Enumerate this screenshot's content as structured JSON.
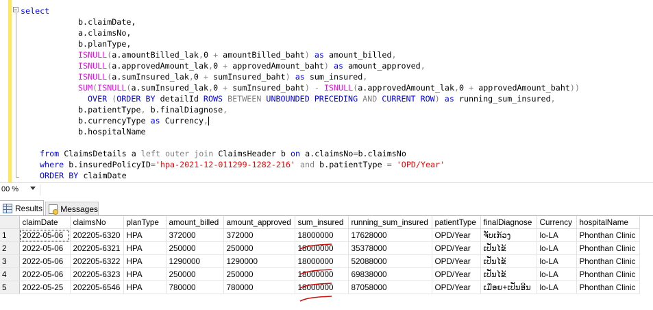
{
  "editor": {
    "lines": [
      [
        {
          "t": "select",
          "c": "kw"
        }
      ],
      [
        {
          "t": "b.claimDate,",
          "c": ""
        }
      ],
      [
        {
          "t": "a.claimsNo,",
          "c": ""
        }
      ],
      [
        {
          "t": "b.planType,",
          "c": ""
        }
      ],
      [
        {
          "t": "ISNULL",
          "c": "fn"
        },
        {
          "t": "(",
          "c": "gr"
        },
        {
          "t": "a.amountBilled_lak",
          "c": ""
        },
        {
          "t": ",",
          "c": "gr"
        },
        {
          "t": "0 ",
          "c": ""
        },
        {
          "t": "+",
          "c": "gr"
        },
        {
          "t": " amountBilled_baht",
          "c": ""
        },
        {
          "t": ")",
          "c": "gr"
        },
        {
          "t": " as ",
          "c": "kw"
        },
        {
          "t": "amount_billed",
          "c": ""
        },
        {
          "t": ",",
          "c": "gr"
        }
      ],
      [
        {
          "t": "ISNULL",
          "c": "fn"
        },
        {
          "t": "(",
          "c": "gr"
        },
        {
          "t": "a.approvedAmount_lak",
          "c": ""
        },
        {
          "t": ",",
          "c": "gr"
        },
        {
          "t": "0 ",
          "c": ""
        },
        {
          "t": "+",
          "c": "gr"
        },
        {
          "t": " approvedAmount_baht",
          "c": ""
        },
        {
          "t": ")",
          "c": "gr"
        },
        {
          "t": " as ",
          "c": "kw"
        },
        {
          "t": "amount_approved",
          "c": ""
        },
        {
          "t": ",",
          "c": "gr"
        }
      ],
      [
        {
          "t": "ISNULL",
          "c": "fn"
        },
        {
          "t": "(",
          "c": "gr"
        },
        {
          "t": "a.sumInsured_lak",
          "c": ""
        },
        {
          "t": ",",
          "c": "gr"
        },
        {
          "t": "0 ",
          "c": ""
        },
        {
          "t": "+",
          "c": "gr"
        },
        {
          "t": " sumInsured_baht",
          "c": ""
        },
        {
          "t": ")",
          "c": "gr"
        },
        {
          "t": " as ",
          "c": "kw"
        },
        {
          "t": "sum_insured",
          "c": ""
        },
        {
          "t": ",",
          "c": "gr"
        }
      ],
      [
        {
          "t": "SUM",
          "c": "fn"
        },
        {
          "t": "(",
          "c": "gr"
        },
        {
          "t": "ISNULL",
          "c": "fn"
        },
        {
          "t": "(",
          "c": "gr"
        },
        {
          "t": "a.sumInsured_lak",
          "c": ""
        },
        {
          "t": ",",
          "c": "gr"
        },
        {
          "t": "0 ",
          "c": ""
        },
        {
          "t": "+",
          "c": "gr"
        },
        {
          "t": " sumInsured_baht",
          "c": ""
        },
        {
          "t": ")",
          "c": "gr"
        },
        {
          "t": " - ",
          "c": "gr"
        },
        {
          "t": "ISNULL",
          "c": "fn"
        },
        {
          "t": "(",
          "c": "gr"
        },
        {
          "t": "a.approvedAmount_lak",
          "c": ""
        },
        {
          "t": ",",
          "c": "gr"
        },
        {
          "t": "0 ",
          "c": ""
        },
        {
          "t": "+",
          "c": "gr"
        },
        {
          "t": " approvedAmount_baht",
          "c": ""
        },
        {
          "t": "))",
          "c": "gr"
        }
      ],
      [
        {
          "t": "OVER ",
          "c": "kw"
        },
        {
          "t": "(",
          "c": "gr"
        },
        {
          "t": "ORDER BY ",
          "c": "kw"
        },
        {
          "t": "detailId ",
          "c": ""
        },
        {
          "t": "ROWS ",
          "c": "kw"
        },
        {
          "t": "BETWEEN ",
          "c": "gr"
        },
        {
          "t": "UNBOUNDED PRECEDING ",
          "c": "kw"
        },
        {
          "t": "AND ",
          "c": "gr"
        },
        {
          "t": "CURRENT ROW",
          "c": "kw"
        },
        {
          "t": ")",
          "c": "gr"
        },
        {
          "t": " as ",
          "c": "kw"
        },
        {
          "t": "running_sum_insured",
          "c": ""
        },
        {
          "t": ",",
          "c": "gr"
        }
      ],
      [
        {
          "t": "b.patientType",
          "c": ""
        },
        {
          "t": ",",
          "c": "gr"
        },
        {
          "t": " b.finalDiagnose",
          "c": ""
        },
        {
          "t": ",",
          "c": "gr"
        }
      ],
      [
        {
          "t": "b.currencyType ",
          "c": ""
        },
        {
          "t": "as ",
          "c": "kw"
        },
        {
          "t": "Currency",
          "c": ""
        },
        {
          "t": ",",
          "c": "gr"
        }
      ],
      [
        {
          "t": "b.hospitalName",
          "c": ""
        }
      ],
      [],
      [
        {
          "t": "from ",
          "c": "kw"
        },
        {
          "t": "ClaimsDetails a ",
          "c": ""
        },
        {
          "t": "left outer join ",
          "c": "gr"
        },
        {
          "t": "ClaimsHeader b ",
          "c": ""
        },
        {
          "t": "on ",
          "c": "kw"
        },
        {
          "t": "a.claimsNo",
          "c": ""
        },
        {
          "t": "=",
          "c": "gr"
        },
        {
          "t": "b.claimsNo",
          "c": ""
        }
      ],
      [
        {
          "t": "where ",
          "c": "kw"
        },
        {
          "t": "b.insuredPolicyID",
          "c": ""
        },
        {
          "t": "=",
          "c": "gr"
        },
        {
          "t": "'hpa-2021-12-011299-1282-216'",
          "c": "st"
        },
        {
          "t": " and ",
          "c": "gr"
        },
        {
          "t": "b.patientType ",
          "c": ""
        },
        {
          "t": "= ",
          "c": "gr"
        },
        {
          "t": "'OPD/Year'",
          "c": "st"
        }
      ],
      [
        {
          "t": "ORDER BY ",
          "c": "kw"
        },
        {
          "t": "claimDate",
          "c": ""
        }
      ]
    ]
  },
  "status": {
    "zoom": "00 %"
  },
  "tabs": {
    "results": "Results",
    "messages": "Messages"
  },
  "grid": {
    "columns": [
      "",
      "claimDate",
      "claimsNo",
      "planType",
      "amount_billed",
      "amount_approved",
      "sum_insured",
      "running_sum_insured",
      "patientType",
      "finalDiagnose",
      "Currency",
      "hospitalName"
    ],
    "rows": [
      [
        "1",
        "2022-05-06",
        "202205-6320",
        "HPA",
        "372000",
        "372000",
        "18000000",
        "17628000",
        "OPD/Year",
        "ຈັບເກ້ວງ",
        "lo-LA",
        "Phonthan Clinic"
      ],
      [
        "2",
        "2022-05-06",
        "202205-6321",
        "HPA",
        "250000",
        "250000",
        "18000000",
        "35378000",
        "OPD/Year",
        "ເປັນໄຂ້",
        "lo-LA",
        "Phonthan Clinic"
      ],
      [
        "3",
        "2022-05-06",
        "202205-6322",
        "HPA",
        "1290000",
        "1290000",
        "18000000",
        "52088000",
        "OPD/Year",
        "ເປັນໄຂ້",
        "lo-LA",
        "Phonthan Clinic"
      ],
      [
        "4",
        "2022-05-06",
        "202205-6323",
        "HPA",
        "250000",
        "250000",
        "18000000",
        "69838000",
        "OPD/Year",
        "ເປັນໄຂ້",
        "lo-LA",
        "Phonthan Clinic"
      ],
      [
        "5",
        "2022-05-25",
        "202205-6546",
        "HPA",
        "780000",
        "780000",
        "18000000",
        "87058000",
        "OPD/Year",
        "ເມື່ອຍ+ເປັນອີນ",
        "lo-LA",
        "Phonthan Clinic"
      ]
    ]
  },
  "colors": {
    "keyword": "#0000ff",
    "function": "#ff00ff",
    "operator": "#808080",
    "string": "#ff0000",
    "strike": "#d01010"
  }
}
